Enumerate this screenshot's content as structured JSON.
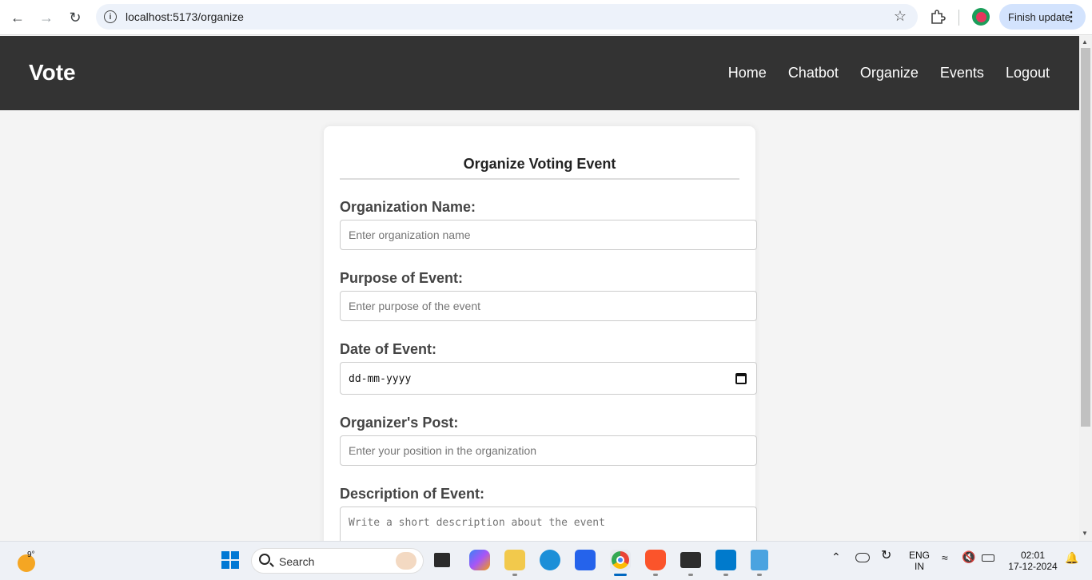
{
  "browser": {
    "url": "localhost:5173/organize",
    "finish_update_label": "Finish update"
  },
  "app": {
    "brand": "Vote",
    "nav": [
      {
        "label": "Home"
      },
      {
        "label": "Chatbot"
      },
      {
        "label": "Organize"
      },
      {
        "label": "Events"
      },
      {
        "label": "Logout"
      }
    ]
  },
  "form": {
    "title": "Organize Voting Event",
    "fields": {
      "org_name": {
        "label": "Organization Name:",
        "placeholder": "Enter organization name",
        "value": ""
      },
      "purpose": {
        "label": "Purpose of Event:",
        "placeholder": "Enter purpose of the event",
        "value": ""
      },
      "date": {
        "label": "Date of Event:",
        "placeholder": "dd-mm-yyyy"
      },
      "post": {
        "label": "Organizer's Post:",
        "placeholder": "Enter your position in the organization",
        "value": ""
      },
      "description": {
        "label": "Description of Event:",
        "placeholder": "Write a short description about the event"
      }
    }
  },
  "taskbar": {
    "weather_temp": "9°",
    "search_label": "Search",
    "lang_top": "ENG",
    "lang_bottom": "IN",
    "time": "02:01",
    "date": "17-12-2024"
  },
  "colors": {
    "header_bg": "#333333",
    "page_bg": "#f4f4f4",
    "accent_update": "#d3e3fd"
  }
}
